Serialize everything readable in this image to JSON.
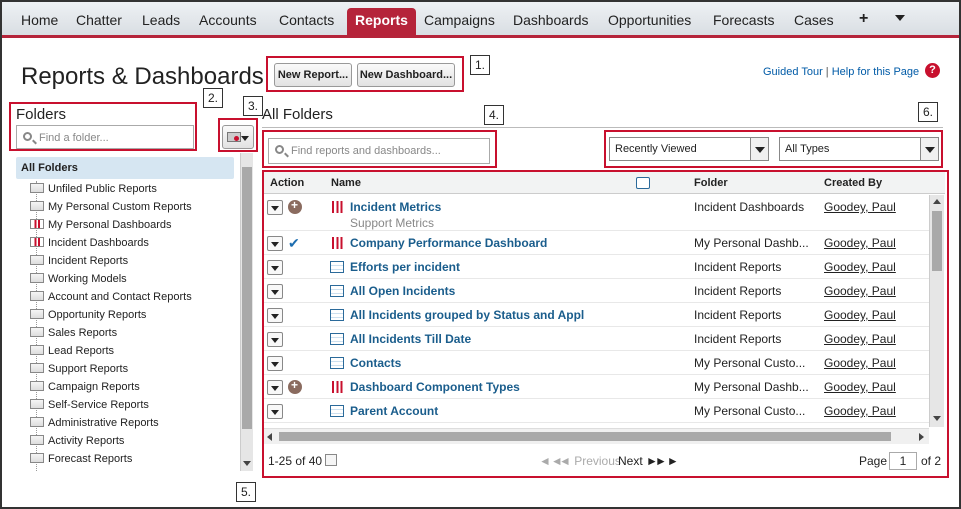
{
  "nav": {
    "tabs": [
      "Home",
      "Chatter",
      "Leads",
      "Accounts",
      "Contacts",
      "Reports",
      "Campaigns",
      "Dashboards",
      "Opportunities",
      "Forecasts",
      "Cases"
    ],
    "active": "Reports",
    "plus": "+"
  },
  "header": {
    "title": "Reports & Dashboards",
    "new_report": "New Report...",
    "new_dashboard": "New Dashboard...",
    "guided_tour": "Guided Tour",
    "separator": "|",
    "help": "Help for this Page",
    "help_icon": "?"
  },
  "callouts": [
    "1.",
    "2.",
    "3.",
    "4.",
    "5.",
    "6."
  ],
  "folders": {
    "title": "Folders",
    "search_placeholder": "Find a folder...",
    "all_folders": "All Folders",
    "items": [
      {
        "label": "Unfiled Public Reports",
        "icon": "folder-icon"
      },
      {
        "label": "My Personal Custom Reports",
        "icon": "folder-icon"
      },
      {
        "label": "My Personal Dashboards",
        "icon": "dashboard-folder-icon"
      },
      {
        "label": "Incident Dashboards",
        "icon": "dashboard-folder-icon"
      },
      {
        "label": "Incident Reports",
        "icon": "folder-icon"
      },
      {
        "label": "Working Models",
        "icon": "folder-icon"
      },
      {
        "label": "Account and Contact Reports",
        "icon": "folder-icon"
      },
      {
        "label": "Opportunity Reports",
        "icon": "folder-icon"
      },
      {
        "label": "Sales Reports",
        "icon": "folder-icon"
      },
      {
        "label": "Lead Reports",
        "icon": "folder-icon"
      },
      {
        "label": "Support Reports",
        "icon": "folder-icon"
      },
      {
        "label": "Campaign Reports",
        "icon": "folder-icon"
      },
      {
        "label": "Self-Service Reports",
        "icon": "folder-icon"
      },
      {
        "label": "Administrative Reports",
        "icon": "folder-icon"
      },
      {
        "label": "Activity Reports",
        "icon": "folder-icon"
      },
      {
        "label": "Forecast Reports",
        "icon": "folder-icon"
      }
    ]
  },
  "main": {
    "title": "All Folders",
    "search_placeholder": "Find reports and dashboards...",
    "filter_recent": "Recently Viewed",
    "filter_type": "All Types",
    "columns": {
      "action": "Action",
      "name": "Name",
      "folder": "Folder",
      "created_by": "Created By"
    },
    "rows": [
      {
        "name": "Incident Metrics",
        "sub": "Support Metrics",
        "folder": "Incident Dashboards",
        "by": "Goodey, Paul",
        "type": "dashboard",
        "action": "plus"
      },
      {
        "name": "Company Performance Dashboard",
        "folder": "My Personal Dashb...",
        "by": "Goodey, Paul",
        "type": "dashboard",
        "action": "check"
      },
      {
        "name": "Efforts per incident",
        "folder": "Incident Reports",
        "by": "Goodey, Paul",
        "type": "report",
        "action": ""
      },
      {
        "name": "All Open Incidents",
        "folder": "Incident Reports",
        "by": "Goodey, Paul",
        "type": "report",
        "action": ""
      },
      {
        "name": "All Incidents grouped by Status and Appl",
        "folder": "Incident Reports",
        "by": "Goodey, Paul",
        "type": "report",
        "action": ""
      },
      {
        "name": "All Incidents Till Date",
        "folder": "Incident Reports",
        "by": "Goodey, Paul",
        "type": "report",
        "action": ""
      },
      {
        "name": "Contacts",
        "folder": "My Personal Custo...",
        "by": "Goodey, Paul",
        "type": "report",
        "action": ""
      },
      {
        "name": "Dashboard Component Types",
        "folder": "My Personal Dashb...",
        "by": "Goodey, Paul",
        "type": "dashboard",
        "action": "plus"
      },
      {
        "name": "Parent Account",
        "folder": "My Personal Custo...",
        "by": "Goodey, Paul",
        "type": "report",
        "action": ""
      }
    ],
    "pager": {
      "range": "1-25 of 40",
      "previous": "Previous",
      "next": "Next",
      "page_label": "Page",
      "page_value": "1",
      "of": "of 2"
    }
  }
}
